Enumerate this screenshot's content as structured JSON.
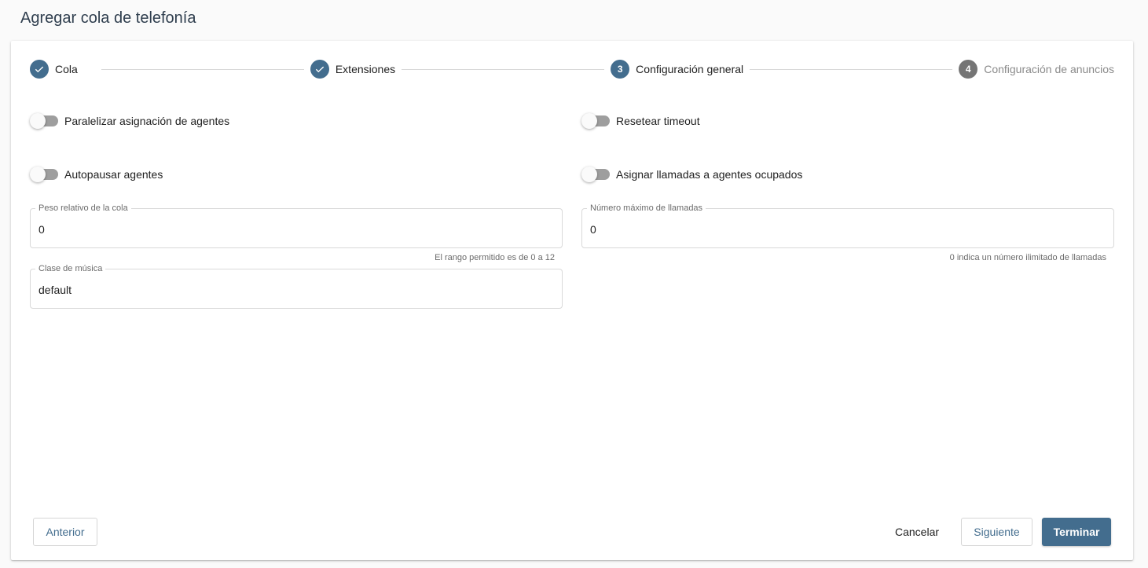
{
  "page": {
    "title": "Agregar cola de telefonía"
  },
  "stepper": {
    "steps": [
      {
        "label": "Cola",
        "state": "done",
        "number": "1"
      },
      {
        "label": "Extensiones",
        "state": "done",
        "number": "2"
      },
      {
        "label": "Configuración general",
        "state": "active",
        "number": "3"
      },
      {
        "label": "Configuración de anuncios",
        "state": "pending",
        "number": "4"
      }
    ]
  },
  "toggles": {
    "parallel": {
      "label": "Paralelizar asignación de agentes",
      "on": false
    },
    "reset_timeout": {
      "label": "Resetear timeout",
      "on": false
    },
    "autopause": {
      "label": "Autopausar agentes",
      "on": false
    },
    "assign_busy": {
      "label": "Asignar llamadas a agentes ocupados",
      "on": false
    }
  },
  "fields": {
    "weight": {
      "label": "Peso relativo de la cola",
      "value": "0",
      "hint": "El rango permitido es de 0 a 12"
    },
    "max_calls": {
      "label": "Número máximo de llamadas",
      "value": "0",
      "hint": "0 indica un número ilimitado de llamadas"
    },
    "music_class": {
      "label": "Clase de música",
      "value": "default"
    }
  },
  "buttons": {
    "previous": "Anterior",
    "cancel": "Cancelar",
    "next": "Siguiente",
    "finish": "Terminar"
  },
  "colors": {
    "primary": "#436d8e",
    "inactive_step": "#757575",
    "toggle_off_track": "#9e9e9e"
  }
}
